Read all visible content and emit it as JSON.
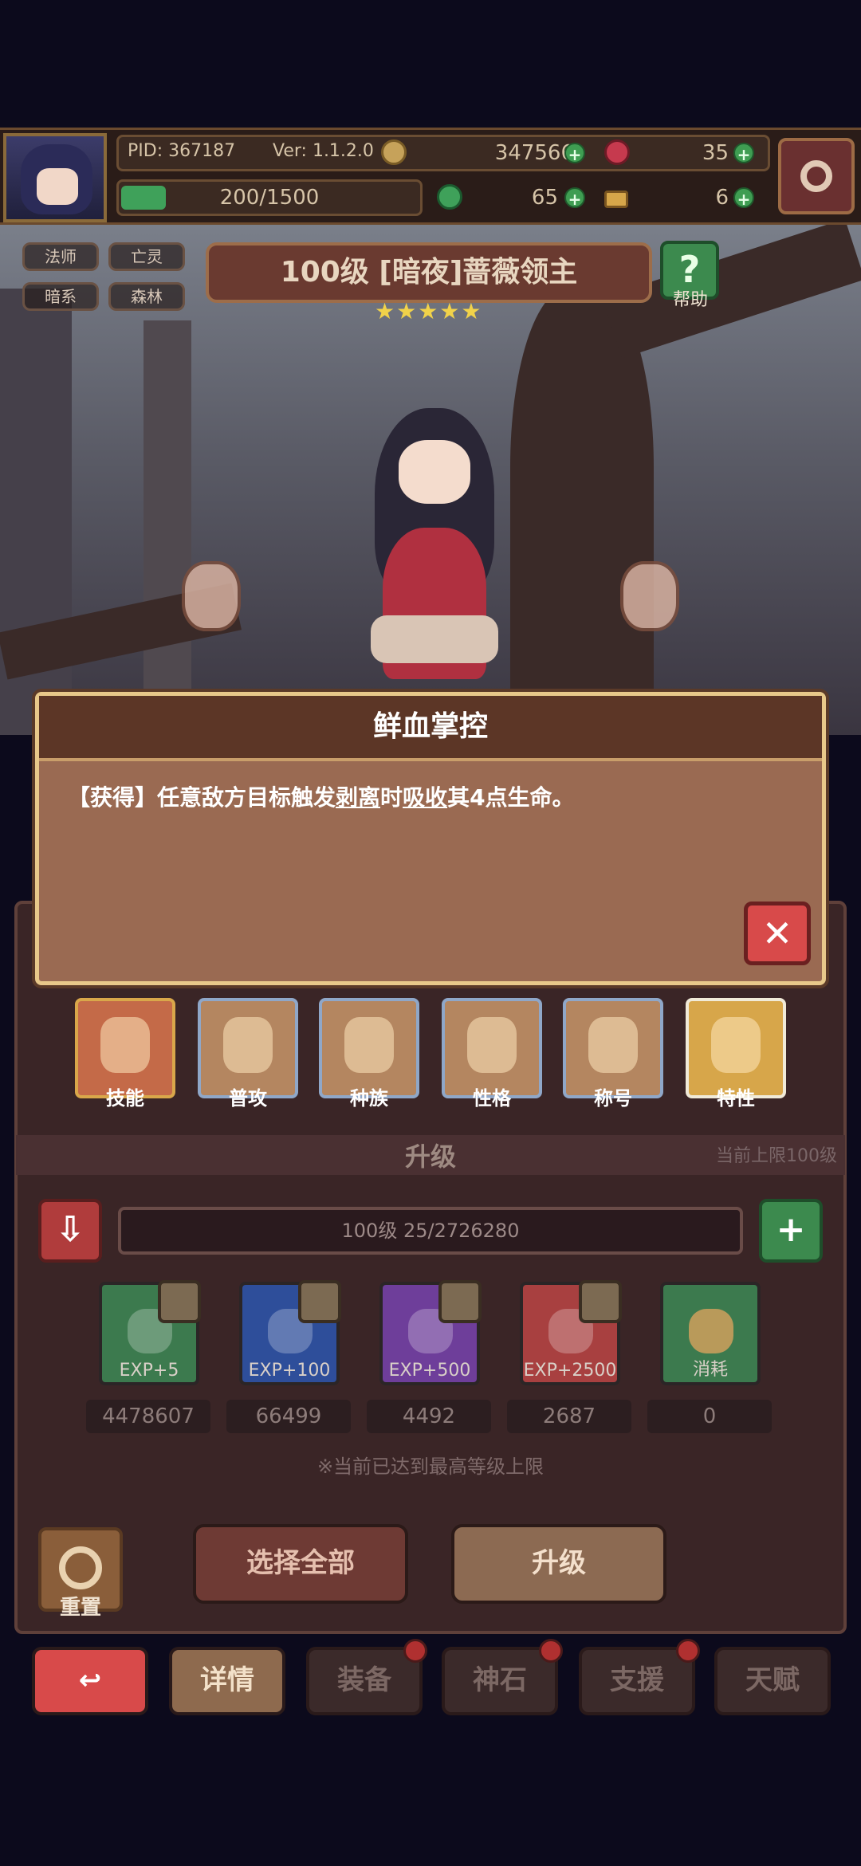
{
  "hud": {
    "pid": "PID: 367187",
    "version": "Ver: 1.1.2.0",
    "gold": "347566",
    "gems": "35",
    "stamina": "200/1500",
    "clover": "65",
    "keys": "6"
  },
  "hero": {
    "tags": [
      "法师",
      "亡灵",
      "暗系",
      "森林"
    ],
    "title": "100级 [暗夜]蔷薇领主",
    "stars": "★★★★★",
    "help_label": "帮助"
  },
  "popup": {
    "title": "鲜血掌控",
    "body_prefix": "【获得】任意敌方目标触发",
    "body_kw1": "剥离",
    "body_mid": "时",
    "body_kw2": "吸收",
    "body_suffix": "其4点生命。"
  },
  "tabs": [
    {
      "label": "技能"
    },
    {
      "label": "普攻"
    },
    {
      "label": "种族"
    },
    {
      "label": "性格"
    },
    {
      "label": "称号"
    },
    {
      "label": "特性"
    }
  ],
  "upgrade": {
    "section_title": "升级",
    "cap_text": "当前上限100级",
    "level_text": "100级  25/2726280",
    "items": [
      {
        "label": "EXP+5",
        "count": "4478607",
        "color": "#3c7a4e"
      },
      {
        "label": "EXP+100",
        "count": "66499",
        "color": "#2e4e9a"
      },
      {
        "label": "EXP+500",
        "count": "4492",
        "color": "#6e3e9a"
      },
      {
        "label": "EXP+2500",
        "count": "2687",
        "color": "#a84040"
      },
      {
        "label": "消耗",
        "count": "0",
        "color": "#3c7a4e"
      }
    ],
    "note": "※当前已达到最高等级上限",
    "reset_label": "重置",
    "select_all": "选择全部",
    "upgrade_btn": "升级"
  },
  "nav": {
    "detail": "详情",
    "equip": "装备",
    "stone": "神石",
    "support": "支援",
    "talent": "天赋"
  }
}
